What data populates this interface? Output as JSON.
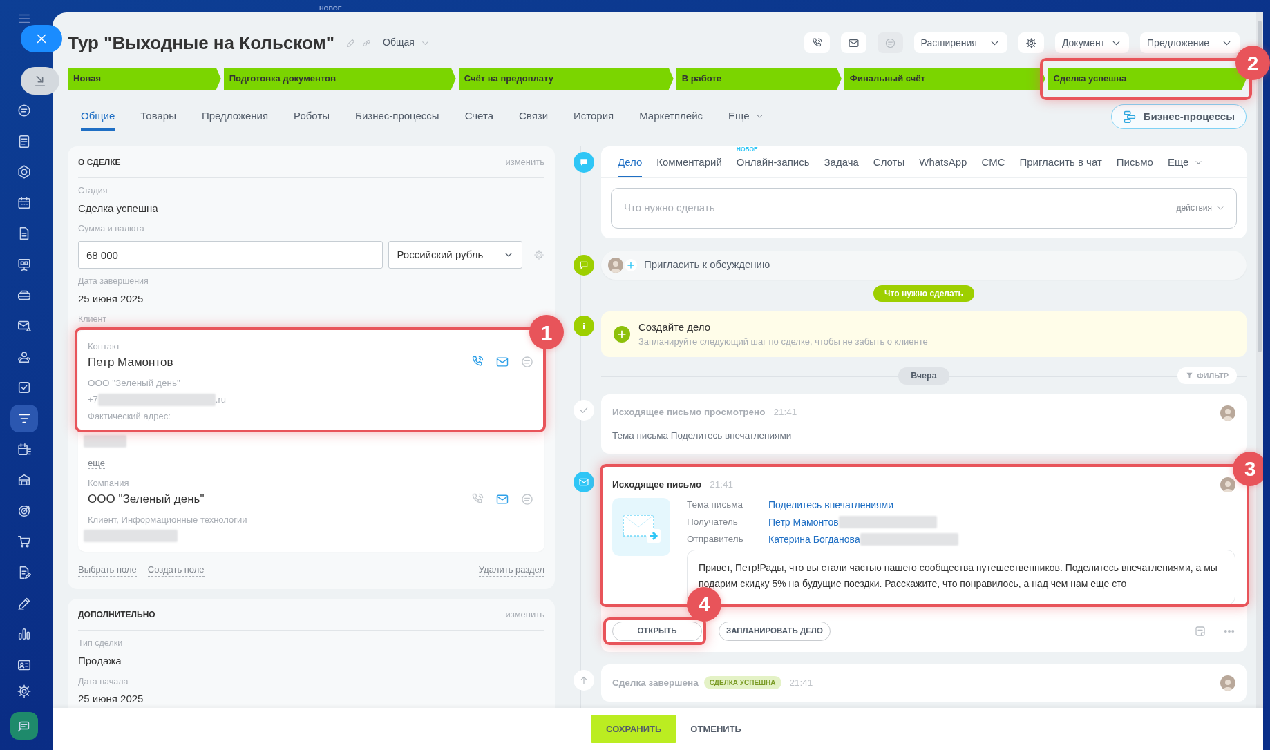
{
  "top_label": "НОВОЕ",
  "sidebar": {
    "items": [
      {
        "kind": "chat",
        "selected": false
      },
      {
        "kind": "news",
        "selected": false
      },
      {
        "kind": "hexagon",
        "selected": false
      },
      {
        "kind": "calendar",
        "selected": false
      },
      {
        "kind": "file",
        "selected": false
      },
      {
        "kind": "board",
        "selected": false
      },
      {
        "kind": "drive",
        "selected": false
      },
      {
        "kind": "mailwarn",
        "selected": false
      },
      {
        "kind": "people",
        "selected": false
      },
      {
        "kind": "check",
        "selected": false
      },
      {
        "kind": "filter",
        "selected": true
      },
      {
        "kind": "calplan",
        "selected": false
      },
      {
        "kind": "store",
        "selected": false
      },
      {
        "kind": "target",
        "selected": false
      },
      {
        "kind": "cart",
        "selected": false
      },
      {
        "kind": "docedit",
        "selected": false
      },
      {
        "kind": "pen",
        "selected": false
      },
      {
        "kind": "chart",
        "selected": false
      },
      {
        "kind": "idcard",
        "selected": false
      }
    ],
    "bottom_items": [
      {
        "kind": "gear",
        "selected": false
      },
      {
        "kind": "app",
        "selected": false
      }
    ]
  },
  "header": {
    "title": "Тур \"Выходные на Кольском\"",
    "category": "Общая"
  },
  "toolbar": [
    {
      "kind": "phone",
      "disabled": false
    },
    {
      "kind": "mail",
      "disabled": false
    },
    {
      "kind": "chat",
      "disabled": true
    },
    {
      "kind": "split",
      "label": "Расширения"
    },
    {
      "kind": "gear",
      "disabled": false
    },
    {
      "kind": "dropdown",
      "label": "Документ"
    },
    {
      "kind": "split",
      "label": "Предложение"
    }
  ],
  "stages": [
    {
      "label": "Новая",
      "done": true
    },
    {
      "label": "Подготовка документов",
      "done": true
    },
    {
      "label": "Счёт на предоплату",
      "done": true
    },
    {
      "label": "В работе",
      "done": true
    },
    {
      "label": "Финальный счёт",
      "done": true
    },
    {
      "label": "Сделка успешна",
      "done": true,
      "callout": "2"
    }
  ],
  "tabs": [
    {
      "label": "Общие",
      "selected": true
    },
    {
      "label": "Товары",
      "selected": false
    },
    {
      "label": "Предложения",
      "selected": false
    },
    {
      "label": "Роботы",
      "selected": false
    },
    {
      "label": "Бизнес-процессы",
      "selected": false
    },
    {
      "label": "Счета",
      "selected": false
    },
    {
      "label": "Связи",
      "selected": false
    },
    {
      "label": "История",
      "selected": false
    },
    {
      "label": "Маркетплейс",
      "selected": false
    }
  ],
  "tabs_more": "Еще",
  "bp_button": "Бизнес-процессы",
  "deal_card": {
    "title": "О СДЕЛКЕ",
    "edit": "изменить",
    "fields": [
      {
        "kind": "text",
        "label": "Стадия",
        "value": "Сделка успешна"
      },
      {
        "kind": "money",
        "label": "Сумма и валюта",
        "value": "68 000",
        "currency": "Российский рубль"
      },
      {
        "kind": "text",
        "label": "Дата завершения",
        "value": "25 июня 2025"
      }
    ],
    "client": {
      "label": "Клиент",
      "contact": {
        "callout": "1",
        "label": "Контакт",
        "name": "Петр Мамонтов",
        "company": "ООО \"Зеленый день\"",
        "phone_prefix": "+7",
        "email_suffix": ".ru",
        "address_label": "Фактический адрес:",
        "more": "еще",
        "channels": [
          {
            "kind": "phone",
            "active": true
          },
          {
            "kind": "mail",
            "active": true
          },
          {
            "kind": "chat",
            "active": false
          }
        ]
      },
      "company": {
        "label": "Компания",
        "name": "ООО \"Зеленый день\"",
        "details": "Клиент, Информационные технологии",
        "channels": [
          {
            "kind": "phone",
            "active": false
          },
          {
            "kind": "mail",
            "active": true
          },
          {
            "kind": "chat",
            "active": false
          }
        ]
      }
    },
    "links": [
      "Выбрать поле",
      "Создать поле"
    ],
    "delete_link": "Удалить раздел"
  },
  "extra_card": {
    "title": "ДОПОЛНИТЕЛЬНО",
    "edit": "изменить",
    "fields": [
      {
        "kind": "text",
        "label": "Тип сделки",
        "value": "Продажа"
      },
      {
        "kind": "text",
        "label": "Дата начала",
        "value": "25 июня 2025"
      }
    ]
  },
  "composer": {
    "tabs": [
      {
        "label": "Дело",
        "selected": true
      },
      {
        "label": "Комментарий",
        "selected": false
      },
      {
        "label": "Онлайн-запись",
        "selected": false,
        "badge": "НОВОЕ"
      },
      {
        "label": "Задача",
        "selected": false
      },
      {
        "label": "Слоты",
        "selected": false
      },
      {
        "label": "WhatsApp",
        "selected": false
      },
      {
        "label": "СМС",
        "selected": false
      },
      {
        "label": "Пригласить в чат",
        "selected": false
      },
      {
        "label": "Письмо",
        "selected": false
      }
    ],
    "more": "Еще",
    "placeholder": "Что нужно сделать",
    "actions": "действия"
  },
  "invite": "Пригласить к обсуждению",
  "todo_divider": "Что нужно сделать",
  "create_task": {
    "title": "Создайте дело",
    "hint": "Запланируйте следующий шаг по сделке, чтобы не забыть о клиенте"
  },
  "day_divider": "Вчера",
  "filter": "ФИЛЬТР",
  "events": [
    {
      "kind": "viewed",
      "title": "Исходящее письмо просмотрено",
      "time": "21:41",
      "text": "Тема письма Поделитесь впечатлениями"
    },
    {
      "kind": "email",
      "callout": "3",
      "title": "Исходящее письмо",
      "time": "21:41",
      "rows": [
        {
          "label": "Тема письма",
          "value": "Поделитесь впечатлениями",
          "blurred": false
        },
        {
          "label": "Получатель",
          "value": "Петр Мамонтов",
          "blurred": true
        },
        {
          "label": "Отправитель",
          "value": "Катерина Богданова",
          "blurred": true
        }
      ],
      "body": "Привет, Петр!Рады, что вы стали частью нашего сообщества путешественников. Поделитесь впечатлениями, а мы подарим скидку 5% на будущие поездки. Расскажите, что понравилось, а над чем нам еще сто",
      "buttons": [
        {
          "label": "ОТКРЫТЬ",
          "callout": "4"
        },
        {
          "label": "ЗАПЛАНИРОВАТЬ ДЕЛО"
        }
      ]
    },
    {
      "kind": "closed",
      "title": "Сделка завершена",
      "badge": "СДЕЛКА УСПЕШНА",
      "time": "21:41"
    }
  ],
  "footer": {
    "save": "СОХРАНИТЬ",
    "cancel": "ОТМЕНИТЬ"
  }
}
